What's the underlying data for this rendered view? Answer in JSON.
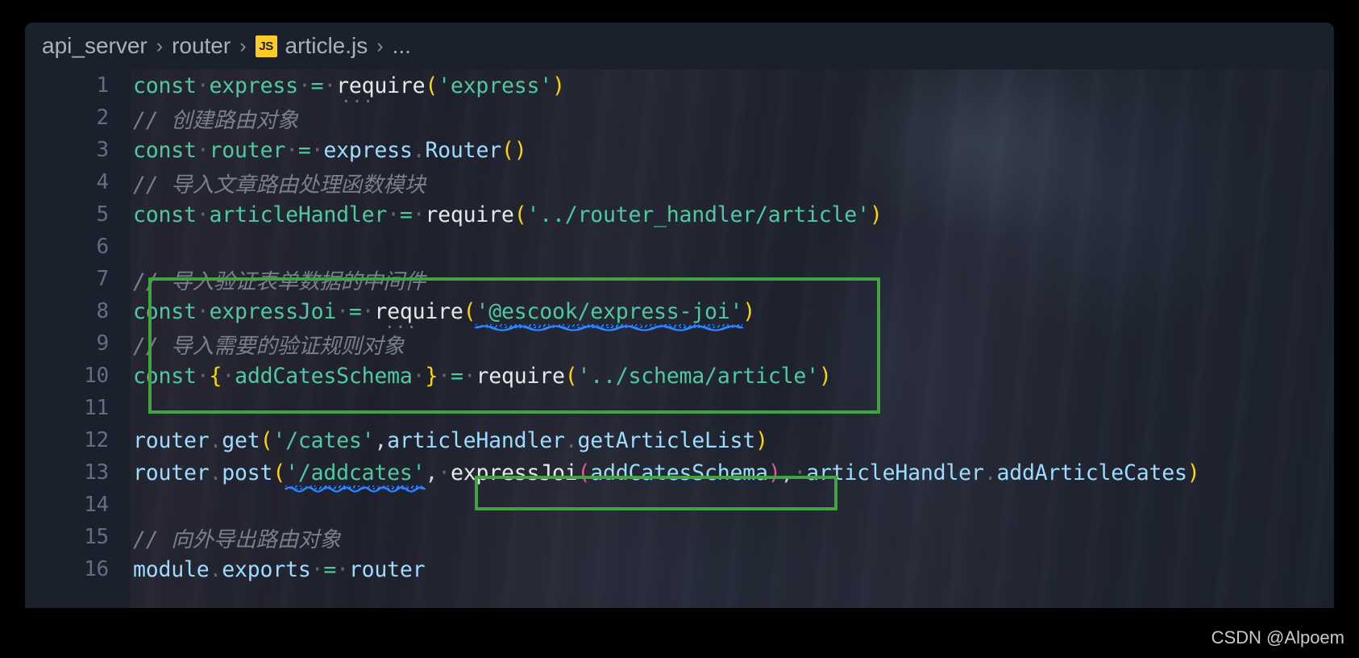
{
  "window": {
    "app": "vscode-editor",
    "theme_bg": "#1b212c",
    "accent_annotation": "#43a340"
  },
  "breadcrumb": {
    "name": "breadcrumb",
    "separator": "›",
    "file_icon_label": "JS",
    "file_icon_bg": "#ffca28",
    "items": [
      {
        "label": "api_server"
      },
      {
        "label": "router"
      },
      {
        "label": "article.js"
      },
      {
        "label": "..."
      }
    ]
  },
  "editor": {
    "language": "javascript",
    "line_count_visible": 16,
    "lines": [
      {
        "number": "1",
        "text": "const express = require('express')"
      },
      {
        "number": "2",
        "text": "// 创建路由对象"
      },
      {
        "number": "3",
        "text": "const router = express.Router()"
      },
      {
        "number": "4",
        "text": "// 导入文章路由处理函数模块"
      },
      {
        "number": "5",
        "text": "const articleHandler = require('../router_handler/article')"
      },
      {
        "number": "6",
        "text": ""
      },
      {
        "number": "7",
        "text": "// 导入验证表单数据的中间件"
      },
      {
        "number": "8",
        "text": "const expressJoi = require('@escook/express-joi')"
      },
      {
        "number": "9",
        "text": "// 导入需要的验证规则对象"
      },
      {
        "number": "10",
        "text": "const { addCatesSchema } = require('../schema/article')"
      },
      {
        "number": "11",
        "text": ""
      },
      {
        "number": "12",
        "text": "router.get('/cates',articleHandler.getArticleList)"
      },
      {
        "number": "13",
        "text": "router.post('/addcates', expressJoi(addCatesSchema), articleHandler.addArticleCates)"
      },
      {
        "number": "14",
        "text": ""
      },
      {
        "number": "15",
        "text": "// 向外导出路由对象"
      },
      {
        "number": "16",
        "text": "module.exports = router"
      }
    ],
    "tokens": {
      "const": "const",
      "require": "require",
      "express_str": "'express'",
      "express": "express",
      "Router": "Router",
      "router": "router",
      "articleHandler": "articleHandler",
      "expressJoi": "expressJoi",
      "addCatesSchema": "addCatesSchema",
      "module": "module",
      "exports": "exports",
      "get": "get",
      "post": "post",
      "getArticleList": "getArticleList",
      "addArticleCates": "addArticleCates",
      "path_router_handler": "'../router_handler/article'",
      "path_escook": "'@escook/express-joi'",
      "path_schema": "'../schema/article'",
      "route_cates": "'/cates'",
      "route_addcates": "'/addcates'"
    },
    "comments": {
      "c2": "// 创建路由对象",
      "c4": "// 导入文章路由处理函数模块",
      "c7": "// 导入验证表单数据的中间件",
      "c9": "// 导入需要的验证规则对象",
      "c15": "// 向外导出路由对象"
    },
    "diagnostics": [
      {
        "line": "8",
        "word": "@escook",
        "kind": "spell-warning",
        "color": "#2f86ff"
      },
      {
        "line": "13",
        "word": "addcates",
        "kind": "spell-warning",
        "color": "#2f86ff"
      }
    ],
    "inlay_hints": [
      {
        "line": "1",
        "text": "..."
      },
      {
        "line": "8",
        "text": "..."
      }
    ]
  },
  "annotations": [
    {
      "name": "import-block-highlight",
      "lines": "7-10",
      "color": "#43a340"
    },
    {
      "name": "middleware-highlight",
      "lines": "13",
      "color": "#43a340",
      "target": "expressJoi(addCatesSchema),"
    }
  ],
  "watermark": {
    "text": "CSDN @Alpoem"
  }
}
